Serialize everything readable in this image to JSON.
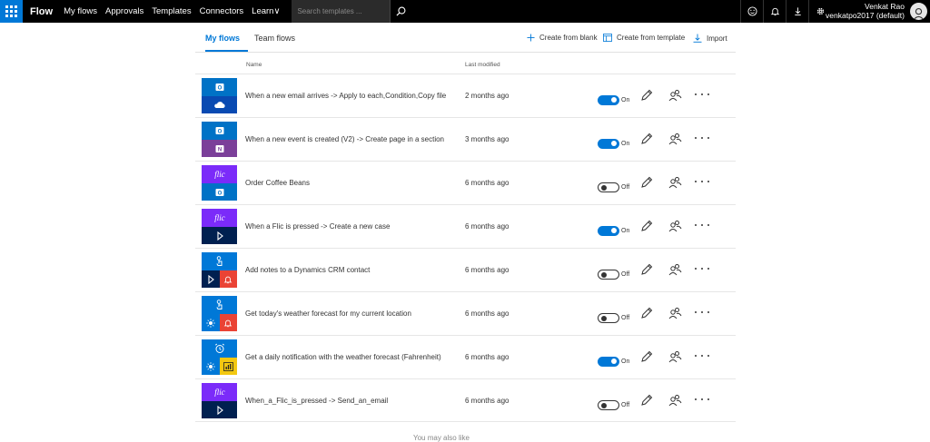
{
  "topbar": {
    "brand": "Flow",
    "nav": [
      "My flows",
      "Approvals",
      "Templates",
      "Connectors",
      "Learn∨"
    ],
    "search_placeholder": "Search templates ...",
    "user_name": "Venkat Rao",
    "user_account": "venkatpo2017 (default)"
  },
  "tabs": {
    "my_flows": "My flows",
    "team_flows": "Team flows"
  },
  "actions": {
    "create_blank": "Create from blank",
    "create_template": "Create from template",
    "import": "Import"
  },
  "columns": {
    "name": "Name",
    "modified": "Last modified"
  },
  "colors": {
    "accent": "#0078d7",
    "outlook": "#0072c6",
    "onedrive": "#094ab2",
    "onenote": "#7b3f99",
    "flic": "#7b2bf9",
    "dynamics": "#002050",
    "notification": "#ea4335",
    "weather": "#0078d7",
    "powerbi": "#f2c811"
  },
  "flows": [
    {
      "name": "When a new email arrives -> Apply to each,Condition,Copy file",
      "modified": "2 months ago",
      "status": "On",
      "on": true
    },
    {
      "name": "When a new event is created (V2) -> Create page in a section",
      "modified": "3 months ago",
      "status": "On",
      "on": true
    },
    {
      "name": "Order Coffee Beans",
      "modified": "6 months ago",
      "status": "Off",
      "on": false
    },
    {
      "name": "When a Flic is pressed -> Create a new case",
      "modified": "6 months ago",
      "status": "On",
      "on": true
    },
    {
      "name": "Add notes to a Dynamics CRM contact",
      "modified": "6 months ago",
      "status": "Off",
      "on": false
    },
    {
      "name": "Get today's weather forecast for my current location",
      "modified": "6 months ago",
      "status": "Off",
      "on": false
    },
    {
      "name": "Get a daily notification with the weather forecast (Fahrenheit)",
      "modified": "6 months ago",
      "status": "On",
      "on": true
    },
    {
      "name": "When_a_Flic_is_pressed -> Send_an_email",
      "modified": "6 months ago",
      "status": "Off",
      "on": false
    }
  ],
  "footer": {
    "also_like": "You may also like"
  }
}
